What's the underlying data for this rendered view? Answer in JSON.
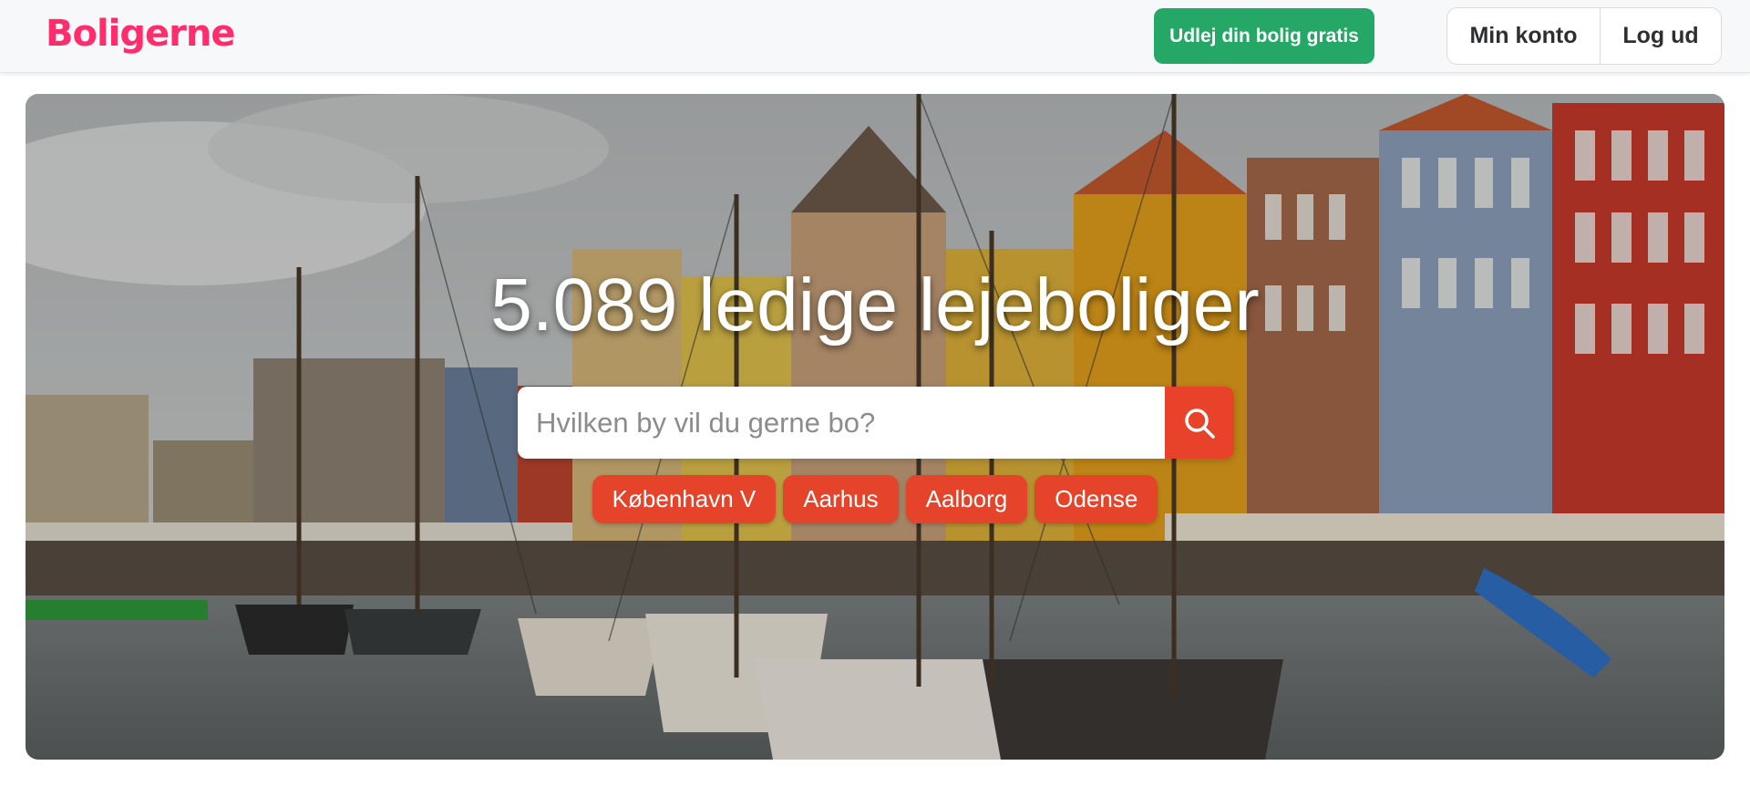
{
  "header": {
    "logo": "Boligerne",
    "cta_label": "Udlej din bolig gratis",
    "account_label": "Min konto",
    "logout_label": "Log ud"
  },
  "hero": {
    "headline": "5.089 ledige lejeboliger",
    "search": {
      "placeholder": "Hvilken by vil du gerne bo?",
      "value": ""
    },
    "quick_links": [
      "København V",
      "Aarhus",
      "Aalborg",
      "Odense"
    ]
  },
  "colors": {
    "brand": "#ff2d6b",
    "cta_green": "#25a866",
    "accent_red": "#e5432a"
  },
  "icons": {
    "search_button": "search-icon"
  }
}
